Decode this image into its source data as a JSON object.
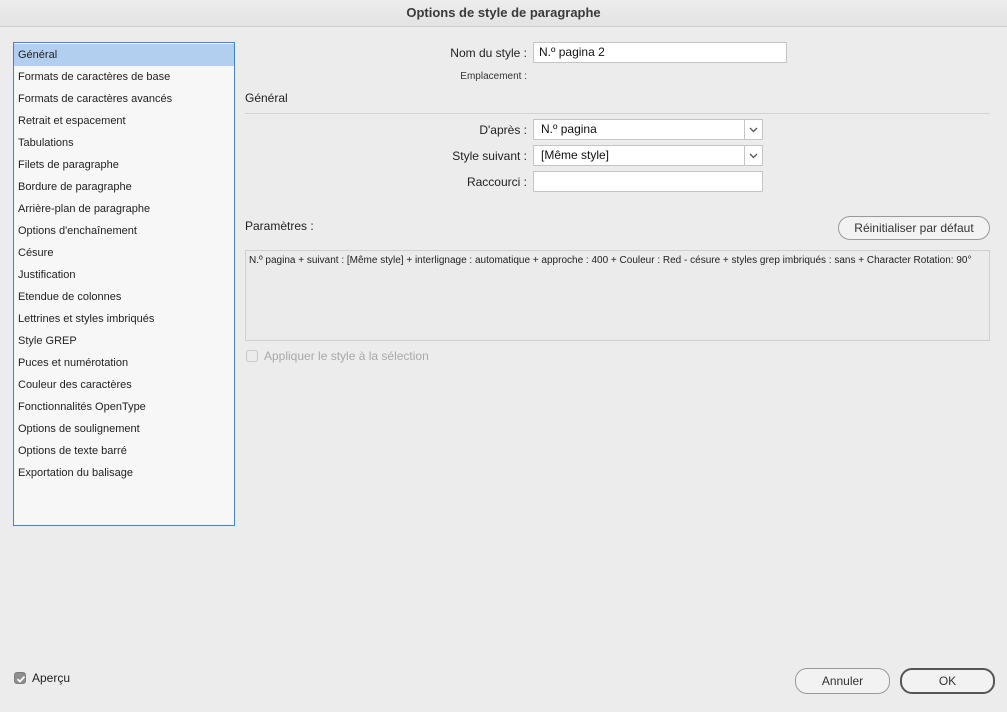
{
  "window": {
    "title": "Options de style de paragraphe"
  },
  "sidebar": {
    "items": [
      {
        "label": "Général"
      },
      {
        "label": "Formats de caractères de base"
      },
      {
        "label": "Formats de caractères avancés"
      },
      {
        "label": "Retrait et espacement"
      },
      {
        "label": "Tabulations"
      },
      {
        "label": "Filets de paragraphe"
      },
      {
        "label": "Bordure de paragraphe"
      },
      {
        "label": "Arrière-plan de paragraphe"
      },
      {
        "label": "Options d'enchaînement"
      },
      {
        "label": "Césure"
      },
      {
        "label": "Justification"
      },
      {
        "label": "Etendue de colonnes"
      },
      {
        "label": "Lettrines et styles imbriqués"
      },
      {
        "label": "Style GREP"
      },
      {
        "label": "Puces et numérotation"
      },
      {
        "label": "Couleur des caractères"
      },
      {
        "label": "Fonctionnalités OpenType"
      },
      {
        "label": "Options de soulignement"
      },
      {
        "label": "Options de texte barré"
      },
      {
        "label": "Exportation du balisage"
      }
    ],
    "selected_index": 0
  },
  "form": {
    "style_name_label": "Nom du style :",
    "style_name_value": "N.º pagina 2",
    "location_label": "Emplacement :",
    "section_title": "Général",
    "based_on_label": "D'après :",
    "based_on_value": "N.º pagina",
    "next_style_label": "Style suivant :",
    "next_style_value": "[Même style]",
    "shortcut_label": "Raccourci :",
    "shortcut_value": "",
    "params_label": "Paramètres :",
    "reset_button": "Réinitialiser par défaut",
    "params_text": "N.º pagina + suivant : [Même style] + interlignage : automatique + approche : 400 + Couleur : Red - césure + styles grep imbriqués : sans + Character Rotation:  90°",
    "apply_label": "Appliquer le style à la sélection"
  },
  "footer": {
    "preview_label": "Aperçu",
    "preview_checked": true,
    "cancel_button": "Annuler",
    "ok_button": "OK"
  },
  "colors": {
    "selection": "#b2cff0",
    "focus_border": "#3d84d8"
  }
}
